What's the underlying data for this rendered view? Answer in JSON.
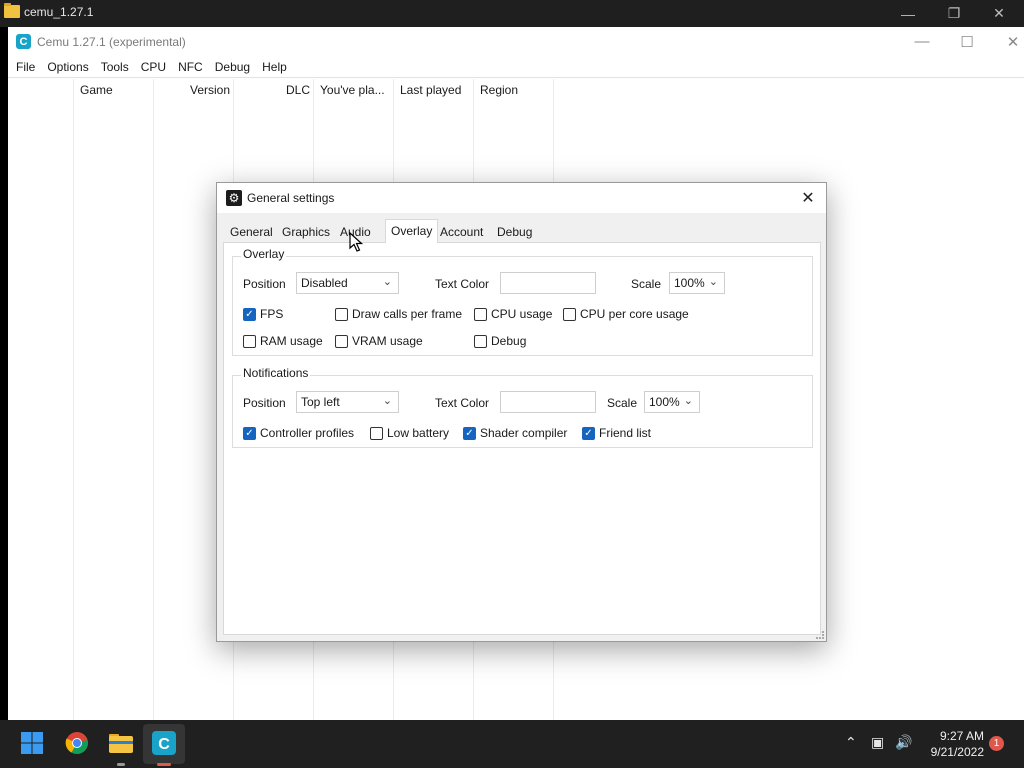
{
  "explorer": {
    "title": "cemu_1.27.1",
    "icon": "folder-icon"
  },
  "cemu": {
    "title": "Cemu 1.27.1 (experimental)",
    "logo_letter": "C",
    "menu": [
      "File",
      "Options",
      "Tools",
      "CPU",
      "NFC",
      "Debug",
      "Help"
    ],
    "columns": [
      "Game",
      "Version",
      "DLC",
      "You've pla...",
      "Last played",
      "Region"
    ]
  },
  "dialog": {
    "title": "General settings",
    "close_glyph": "✕",
    "tabs": [
      "General",
      "Graphics",
      "Audio",
      "Overlay",
      "Account",
      "Debug"
    ],
    "active_tab": "Overlay",
    "overlay": {
      "group_title": "Overlay",
      "position_label": "Position",
      "position_value": "Disabled",
      "text_color_label": "Text Color",
      "scale_label": "Scale",
      "scale_value": "100%",
      "checkboxes": [
        {
          "label": "FPS",
          "checked": true
        },
        {
          "label": "Draw calls per frame",
          "checked": false
        },
        {
          "label": "CPU usage",
          "checked": false
        },
        {
          "label": "CPU per core usage",
          "checked": false
        },
        {
          "label": "RAM usage",
          "checked": false
        },
        {
          "label": "VRAM usage",
          "checked": false
        },
        {
          "label": "Debug",
          "checked": false
        }
      ]
    },
    "notifications": {
      "group_title": "Notifications",
      "position_label": "Position",
      "position_value": "Top left",
      "text_color_label": "Text Color",
      "scale_label": "Scale",
      "scale_value": "100%",
      "checkboxes": [
        {
          "label": "Controller profiles",
          "checked": true
        },
        {
          "label": "Low battery",
          "checked": false
        },
        {
          "label": "Shader compiler",
          "checked": true
        },
        {
          "label": "Friend list",
          "checked": true
        }
      ]
    }
  },
  "taskbar": {
    "time": "9:27 AM",
    "date": "9/21/2022",
    "notification_count": "1"
  }
}
